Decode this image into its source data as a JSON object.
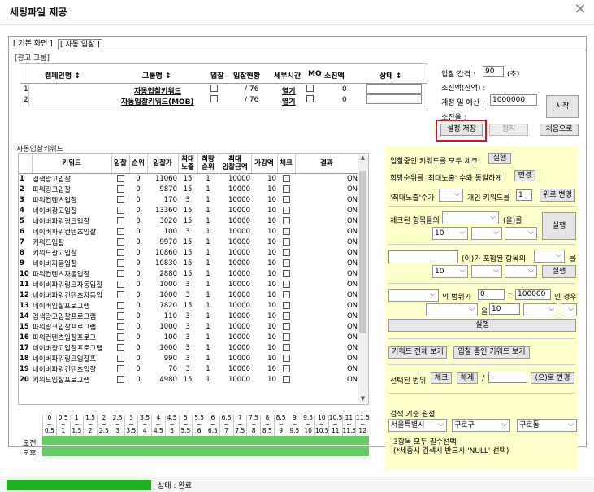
{
  "window": {
    "title": "세팅파일 제공"
  },
  "tabs": [
    {
      "label": "[ 기본 화면 ]"
    },
    {
      "label": "[ 자동 입찰 ]"
    }
  ],
  "ad_group": {
    "label": "[광고 그룹]",
    "headers": [
      "캠페인명 ↕",
      "그룹명 ↕",
      "입찰",
      "입찰현황",
      "세부시간",
      "MO",
      "소진액",
      "상태 ↕"
    ],
    "rows": [
      {
        "no": "1",
        "group": "자동입찰키워드",
        "bid_status": "/ 76",
        "detail": "열기",
        "spent": "0"
      },
      {
        "no": "2",
        "group": "자동입찰키워드(MOB)",
        "bid_status": "/ 76",
        "detail": "열기",
        "spent": "0"
      }
    ]
  },
  "right_info": {
    "interval_label": "입찰 간격 :",
    "interval_value": "90",
    "interval_unit": "(초)",
    "spent_label": "소진액(잔액) :",
    "budget_label": "계정 일 예산 :",
    "budget_value": "1000000",
    "burn_label": "소진율 :",
    "start": "시작",
    "save": "설정 저장",
    "stop": "정지",
    "reset": "처음으로"
  },
  "keywords": {
    "label": "자동입찰키워드",
    "headers": [
      "키워드",
      "입찰",
      "순위",
      "입찰가",
      "최대\n노출",
      "희망\n순위",
      "최대\n입찰금액",
      "가감액",
      "체크",
      "결과"
    ],
    "rows": [
      [
        "1",
        "검색광고입찰",
        "0",
        "11060",
        "15",
        "1",
        "10000",
        "10",
        "ON"
      ],
      [
        "2",
        "파워링크입찰",
        "0",
        "9870",
        "15",
        "1",
        "10000",
        "10",
        "ON"
      ],
      [
        "3",
        "파워컨텐츠입찰",
        "0",
        "170",
        "3",
        "1",
        "10000",
        "10",
        "ON"
      ],
      [
        "4",
        "네이버광고입찰",
        "0",
        "13360",
        "15",
        "1",
        "10000",
        "10",
        "ON"
      ],
      [
        "5",
        "네이버파워링크입찰",
        "0",
        "3020",
        "15",
        "1",
        "10000",
        "10",
        "ON"
      ],
      [
        "6",
        "네이버파워컨텐츠입찰",
        "0",
        "100",
        "3",
        "1",
        "10000",
        "10",
        "ON"
      ],
      [
        "7",
        "키워드입찰",
        "0",
        "9970",
        "15",
        "1",
        "10000",
        "10",
        "ON"
      ],
      [
        "8",
        "키워드광고입찰",
        "0",
        "10860",
        "15",
        "1",
        "10000",
        "10",
        "ON"
      ],
      [
        "9",
        "네이버자동입찰",
        "0",
        "10830",
        "15",
        "1",
        "10000",
        "10",
        "ON"
      ],
      [
        "10",
        "파워컨텐츠자동입찰",
        "0",
        "2880",
        "15",
        "1",
        "10000",
        "10",
        "ON"
      ],
      [
        "11",
        "네이버파워링크자동입찰",
        "0",
        "1000",
        "3",
        "1",
        "10000",
        "10",
        "ON"
      ],
      [
        "12",
        "네이버파워컨텐츠자동입",
        "0",
        "1000",
        "3",
        "1",
        "10000",
        "10",
        "ON"
      ],
      [
        "13",
        "네이버입찰프로그램",
        "0",
        "7820",
        "15",
        "1",
        "10000",
        "10",
        "ON"
      ],
      [
        "14",
        "검색광고입찰프로그램",
        "0",
        "110",
        "3",
        "1",
        "10000",
        "10",
        "ON"
      ],
      [
        "15",
        "파워링크입찰프로그램",
        "0",
        "1000",
        "3",
        "1",
        "10000",
        "10",
        "ON"
      ],
      [
        "16",
        "파워컨텐츠입찰프로그",
        "0",
        "100",
        "3",
        "1",
        "10000",
        "10",
        "ON"
      ],
      [
        "17",
        "네이버광고입찰프로그램",
        "0",
        "1000",
        "3",
        "1",
        "10000",
        "10",
        "ON"
      ],
      [
        "18",
        "네이버파워링크입찰프",
        "0",
        "990",
        "3",
        "1",
        "10000",
        "10",
        "ON"
      ],
      [
        "19",
        "네이버파워컨텐츠입찰",
        "0",
        "70",
        "3",
        "1",
        "10000",
        "10",
        "ON"
      ],
      [
        "20",
        "키워드입찰프로그램",
        "0",
        "4980",
        "15",
        "1",
        "10000",
        "10",
        "ON"
      ]
    ]
  },
  "schedule": {
    "times": [
      "0\n~\n0.5",
      "0.5\n~\n1",
      "1\n~\n1.5",
      "1.5\n~\n2",
      "2\n~\n2.5",
      "2.5\n~\n3",
      "3\n~\n3.5",
      "3.5\n~\n4",
      "4\n~\n4.5",
      "4.5\n~\n5",
      "5\n~\n5.5",
      "5.5\n~\n6",
      "6\n~\n6.5",
      "6.5\n~\n7",
      "7\n~\n7.5",
      "7.5\n~\n8",
      "8\n~\n8.5",
      "8.5\n~\n9",
      "9\n~\n9.5",
      "9.5\n~\n10",
      "10\n~\n10.5",
      "10.5\n~\n11",
      "11\n~\n11.5",
      "11.5\n~\n12"
    ],
    "am": "오전",
    "pm": "오후"
  },
  "panel": {
    "check_all": "입찰중인 키워드를 모두 체크",
    "run": "실행",
    "desired_rank": "희망순위를 '최대노출' 수와 동일하게",
    "change": "변경",
    "max_exposure": "'최대노출'수가",
    "individual": "개인 키워드를",
    "individual_value": "1",
    "up_change": "위로 변경",
    "checked_items": "체크된 항목들의",
    "eul": "(을)를",
    "val10": "10",
    "contains": "(이)가 포함된 항목의",
    "reul": "를",
    "range_of": "의 범위가",
    "range_from": "0",
    "tilde": "~",
    "range_to": "100000",
    "if_case": "인 경우",
    "eul2": "을",
    "view_all": "키워드 전체 보기",
    "view_bidding": "입찰 중인 키워드 보기",
    "selected_range": "선택된 범위",
    "check": "체크",
    "uncheck": "해제",
    "slash": "/",
    "eu_change": "(으)로 변경",
    "search_base": "검색 기준 원점",
    "seoul": "서울특별시",
    "guro": "구로구",
    "gurodong": "구로동",
    "note1": "3항목 모두 필수선택",
    "note2": "(*세종시 검색시 반드시 'NULL' 선택)"
  },
  "status": {
    "text": "상태 : 완료",
    "progress": 1.0
  }
}
